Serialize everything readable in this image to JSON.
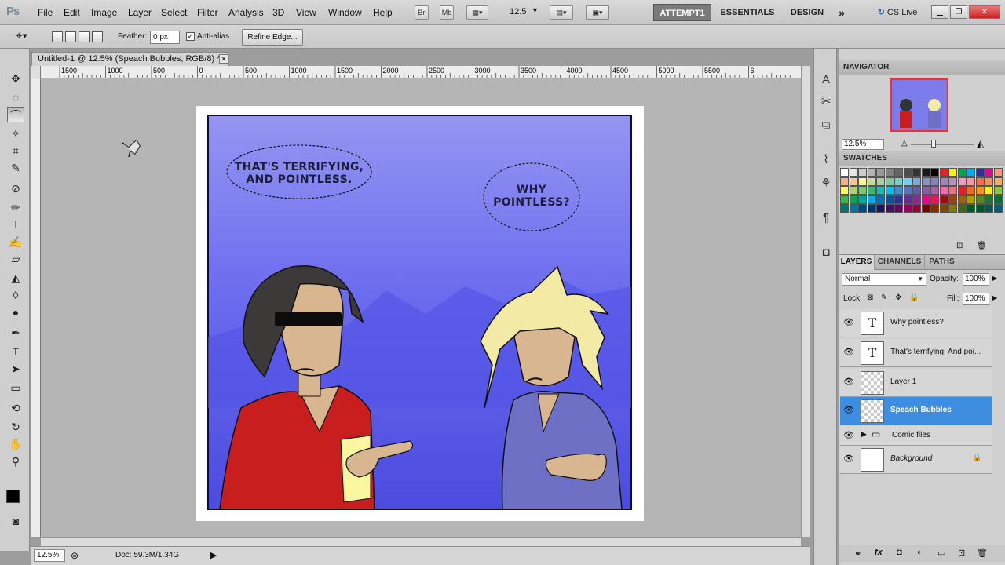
{
  "app": {
    "logo": "Ps"
  },
  "menu": [
    "File",
    "Edit",
    "Image",
    "Layer",
    "Select",
    "Filter",
    "Analysis",
    "3D",
    "View",
    "Window",
    "Help"
  ],
  "menubar_buttons": {
    "bridge": "Br",
    "mini_bridge": "Mb",
    "zoom_value": "12.5"
  },
  "workspaces": {
    "active": "ATTEMPT1",
    "essentials": "ESSENTIALS",
    "design": "DESIGN",
    "more": "»",
    "cs_live": "CS Live"
  },
  "options": {
    "feather_label": "Feather:",
    "feather_value": "0 px",
    "antialias_label": "Anti-alias",
    "refine_edge": "Refine Edge..."
  },
  "document": {
    "tab_title": "Untitled-1 @ 12.5% (Speach Bubbles, RGB/8) *",
    "ruler_labels": [
      "1500",
      "1000",
      "500",
      "0",
      "500",
      "1000",
      "1500",
      "2000",
      "2500",
      "3000",
      "3500",
      "4000",
      "4500",
      "5000",
      "5500",
      "6"
    ],
    "zoom": "12.5%",
    "doc_size": "Doc: 59.3M/1.34G"
  },
  "comic": {
    "bubble1_line1": "THAT'S TERRIFYING,",
    "bubble1_line2": "AND POINTLESS.",
    "bubble2_line1": "WHY",
    "bubble2_line2": "POINTLESS?"
  },
  "navigator": {
    "title": "NAVIGATOR",
    "zoom": "12.5%"
  },
  "swatches": {
    "title": "SWATCHES",
    "colors": [
      "#ffffff",
      "#e6e6e6",
      "#cccccc",
      "#b3b3b3",
      "#999999",
      "#808080",
      "#666666",
      "#4d4d4d",
      "#333333",
      "#1a1a1a",
      "#000000",
      "#ed1c24",
      "#fff200",
      "#00a651",
      "#00aeef",
      "#2e3192",
      "#ec008c",
      "#f7977a",
      "#f9ad81",
      "#fdc68a",
      "#fff79a",
      "#c4df9b",
      "#a2d39c",
      "#82ca9d",
      "#7bcdc8",
      "#6ecff6",
      "#7ea7d8",
      "#8493ca",
      "#8882be",
      "#a187be",
      "#bc8dbf",
      "#f49ac2",
      "#f6989d",
      "#f26c4f",
      "#f68e55",
      "#fbaf5c",
      "#fff467",
      "#acd372",
      "#7cc576",
      "#3bb878",
      "#1abbb4",
      "#00bff3",
      "#438cca",
      "#5574b9",
      "#605ca8",
      "#855fa8",
      "#a763a8",
      "#f06ea9",
      "#f26d7d",
      "#ed1c24",
      "#f26522",
      "#f7941d",
      "#fff200",
      "#8dc73f",
      "#39b54a",
      "#00a651",
      "#00a99d",
      "#00aeef",
      "#0072bc",
      "#0054a6",
      "#2e3192",
      "#662d91",
      "#92278f",
      "#ec008c",
      "#ed145b",
      "#9e0b0f",
      "#a0410d",
      "#a36209",
      "#aba000",
      "#598527",
      "#197b30",
      "#007236",
      "#00746b",
      "#0076a3",
      "#004a80",
      "#003471",
      "#1b1464",
      "#440e62",
      "#630460",
      "#9e005d",
      "#9e0039",
      "#790000",
      "#7b2e00",
      "#7d4900",
      "#827b00",
      "#406618",
      "#005e20",
      "#005826",
      "#005952",
      "#005b7f"
    ]
  },
  "layers": {
    "tabs": [
      "LAYERS",
      "CHANNELS",
      "PATHS"
    ],
    "blend_mode": "Normal",
    "opacity_label": "Opacity:",
    "opacity": "100%",
    "lock_label": "Lock:",
    "fill_label": "Fill:",
    "fill": "100%",
    "items": [
      {
        "name": "Why pointless?",
        "kind": "text"
      },
      {
        "name": "That's terrifying, And poi...",
        "kind": "text"
      },
      {
        "name": "Layer 1",
        "kind": "pixel"
      },
      {
        "name": "Speach Bubbles",
        "kind": "pixel",
        "selected": true
      },
      {
        "name": "Comic files",
        "kind": "group"
      },
      {
        "name": "Background",
        "kind": "background"
      }
    ]
  }
}
